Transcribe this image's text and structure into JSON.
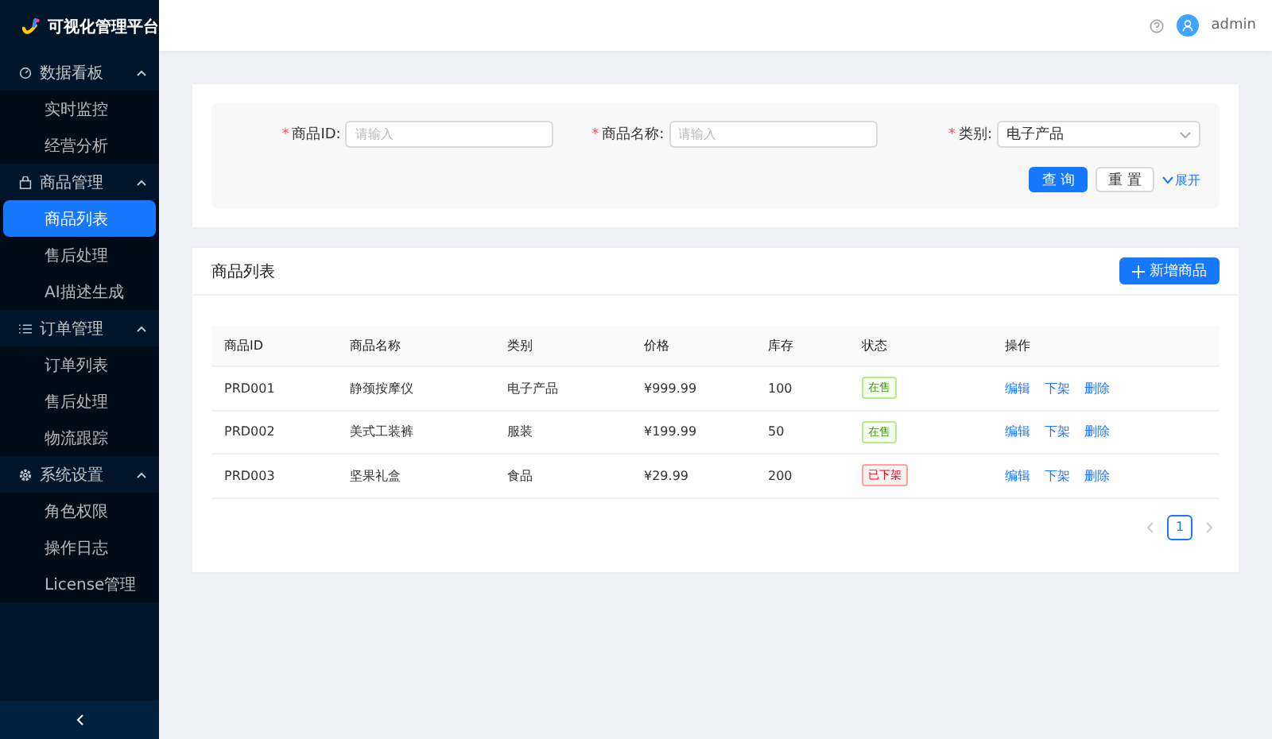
{
  "sidebar": {
    "logo": "可视化管理平台",
    "groups": [
      {
        "label": "数据看板",
        "expanded": true,
        "children": [
          {
            "label": "实时监控",
            "selected": false
          },
          {
            "label": "经营分析",
            "selected": false
          }
        ]
      },
      {
        "label": "商品管理",
        "expanded": true,
        "children": [
          {
            "label": "商品列表",
            "selected": true
          },
          {
            "label": "售后处理",
            "selected": false
          },
          {
            "label": "AI描述生成",
            "selected": false
          }
        ]
      },
      {
        "label": "订单管理",
        "expanded": true,
        "children": [
          {
            "label": "订单列表",
            "selected": false
          },
          {
            "label": "售后处理",
            "selected": false
          },
          {
            "label": "物流跟踪",
            "selected": false
          }
        ]
      },
      {
        "label": "系统设置",
        "expanded": true,
        "children": [
          {
            "label": "角色权限",
            "selected": false
          },
          {
            "label": "操作日志",
            "selected": false
          },
          {
            "label": "License管理",
            "selected": false
          }
        ]
      }
    ]
  },
  "header": {
    "user": "admin"
  },
  "filters": {
    "fields": [
      {
        "kind": "input",
        "required_mark": "*",
        "label": "商品ID:",
        "placeholder": "请输入"
      },
      {
        "kind": "input",
        "required_mark": "*",
        "label": "商品名称:",
        "placeholder": "请输入"
      },
      {
        "kind": "select",
        "required_mark": "*",
        "label": "类别:",
        "value": "电子产品"
      }
    ],
    "query": "查 询",
    "reset": "重 置",
    "expand": "展开"
  },
  "table": {
    "title": "商品列表",
    "add": "新增商品",
    "columns": [
      "商品ID",
      "商品名称",
      "类别",
      "价格",
      "库存",
      "状态",
      "操作"
    ],
    "rows": [
      {
        "cells": [
          "PRD001",
          "静颈按摩仪",
          "电子产品",
          "¥999.99",
          "100"
        ],
        "status": {
          "text": "在售",
          "kind": "success"
        },
        "actions": [
          "编辑",
          "下架",
          "删除"
        ]
      },
      {
        "cells": [
          "PRD002",
          "美式工装裤",
          "服装",
          "¥199.99",
          "50"
        ],
        "status": {
          "text": "在售",
          "kind": "success"
        },
        "actions": [
          "编辑",
          "下架",
          "删除"
        ]
      },
      {
        "cells": [
          "PRD003",
          "坚果礼盒",
          "食品",
          "¥29.99",
          "200"
        ],
        "status": {
          "text": "已下架",
          "kind": "error"
        },
        "actions": [
          "编辑",
          "下架",
          "删除"
        ]
      }
    ],
    "pages": [
      {
        "label": "1",
        "selected": true
      }
    ]
  }
}
